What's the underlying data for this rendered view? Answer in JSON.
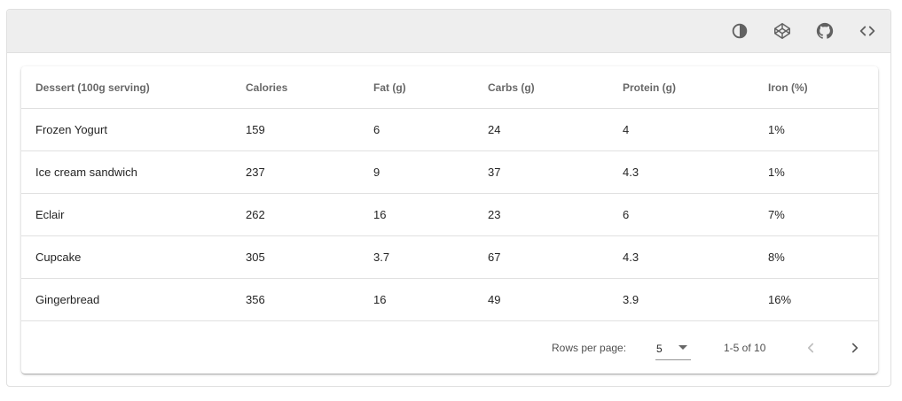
{
  "toolbar": {
    "icons": [
      "invert-colors-icon",
      "codepen-icon",
      "github-icon",
      "code-icon"
    ]
  },
  "table": {
    "headers": {
      "dessert": "Dessert (100g serving)",
      "calories": "Calories",
      "fat": "Fat (g)",
      "carbs": "Carbs (g)",
      "protein": "Protein (g)",
      "iron": "Iron (%)"
    },
    "rows": [
      {
        "dessert": "Frozen Yogurt",
        "calories": "159",
        "fat": "6",
        "carbs": "24",
        "protein": "4",
        "iron": "1%"
      },
      {
        "dessert": "Ice cream sandwich",
        "calories": "237",
        "fat": "9",
        "carbs": "37",
        "protein": "4.3",
        "iron": "1%"
      },
      {
        "dessert": "Eclair",
        "calories": "262",
        "fat": "16",
        "carbs": "23",
        "protein": "6",
        "iron": "7%"
      },
      {
        "dessert": "Cupcake",
        "calories": "305",
        "fat": "3.7",
        "carbs": "67",
        "protein": "4.3",
        "iron": "8%"
      },
      {
        "dessert": "Gingerbread",
        "calories": "356",
        "fat": "16",
        "carbs": "49",
        "protein": "3.9",
        "iron": "16%"
      }
    ]
  },
  "pagination": {
    "rows_per_page_label": "Rows per page:",
    "rows_per_page_value": "5",
    "range_text": "1-5 of 10",
    "prev_disabled": true
  },
  "colors": {
    "toolbar_bg": "#eeeeee",
    "icon": "#616161",
    "divider": "#e0e0e0"
  }
}
